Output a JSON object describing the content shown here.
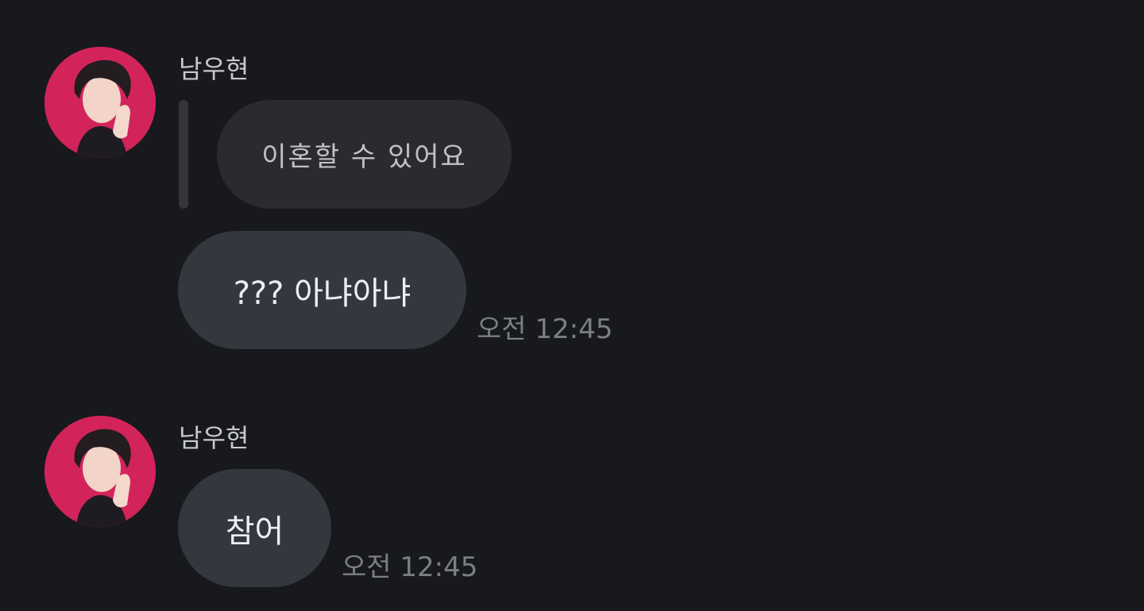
{
  "messages": [
    {
      "sender": "남우현",
      "reply_quote": "이혼할 수 있어요",
      "text": "??? 아냐아냐",
      "time": "오전 12:45"
    },
    {
      "sender": "남우현",
      "text": "참어",
      "time": "오전 12:45"
    }
  ],
  "colors": {
    "background": "#18191d",
    "bubble": "#35373e",
    "quoted_bubble": "#2a2b30",
    "avatar_background": "#d2245a"
  }
}
